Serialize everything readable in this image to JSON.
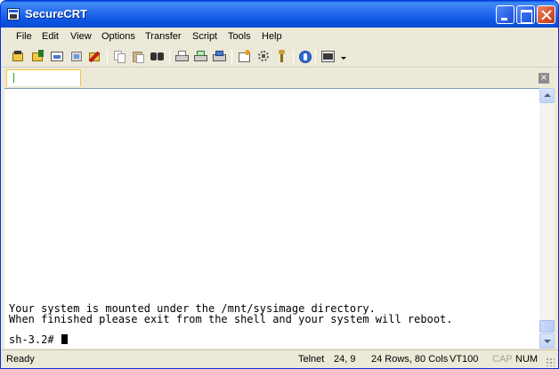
{
  "window": {
    "title": "SecureCRT"
  },
  "menu": {
    "items": [
      "File",
      "Edit",
      "View",
      "Options",
      "Transfer",
      "Script",
      "Tools",
      "Help"
    ]
  },
  "toolbar": {
    "icons": [
      "connect-icon",
      "quick-connect-icon",
      "connect-tab-icon",
      "reconnect-icon",
      "disconnect-icon",
      "copy-icon",
      "paste-icon",
      "find-icon",
      "print-icon",
      "print-selection-icon",
      "print-setup-icon",
      "session-options-icon",
      "global-options-icon",
      "keymap-icon",
      "help-icon",
      "about-icon"
    ]
  },
  "terminal": {
    "lines": [
      "Your system is mounted under the /mnt/sysimage directory.",
      "When finished please exit from the shell and your system will reboot."
    ],
    "prompt": "sh-3.2# "
  },
  "status": {
    "ready": "Ready",
    "protocol": "Telnet",
    "position": "24,  9",
    "size": "24 Rows, 80 Cols",
    "terminal_type": "VT100",
    "cap": "CAP",
    "num": "NUM"
  },
  "tab": {
    "close_label": "×"
  },
  "colors": {
    "titlebar": "#0a54e0",
    "tab_border": "#f6c24b",
    "terminal_bg": "#ffffff"
  }
}
